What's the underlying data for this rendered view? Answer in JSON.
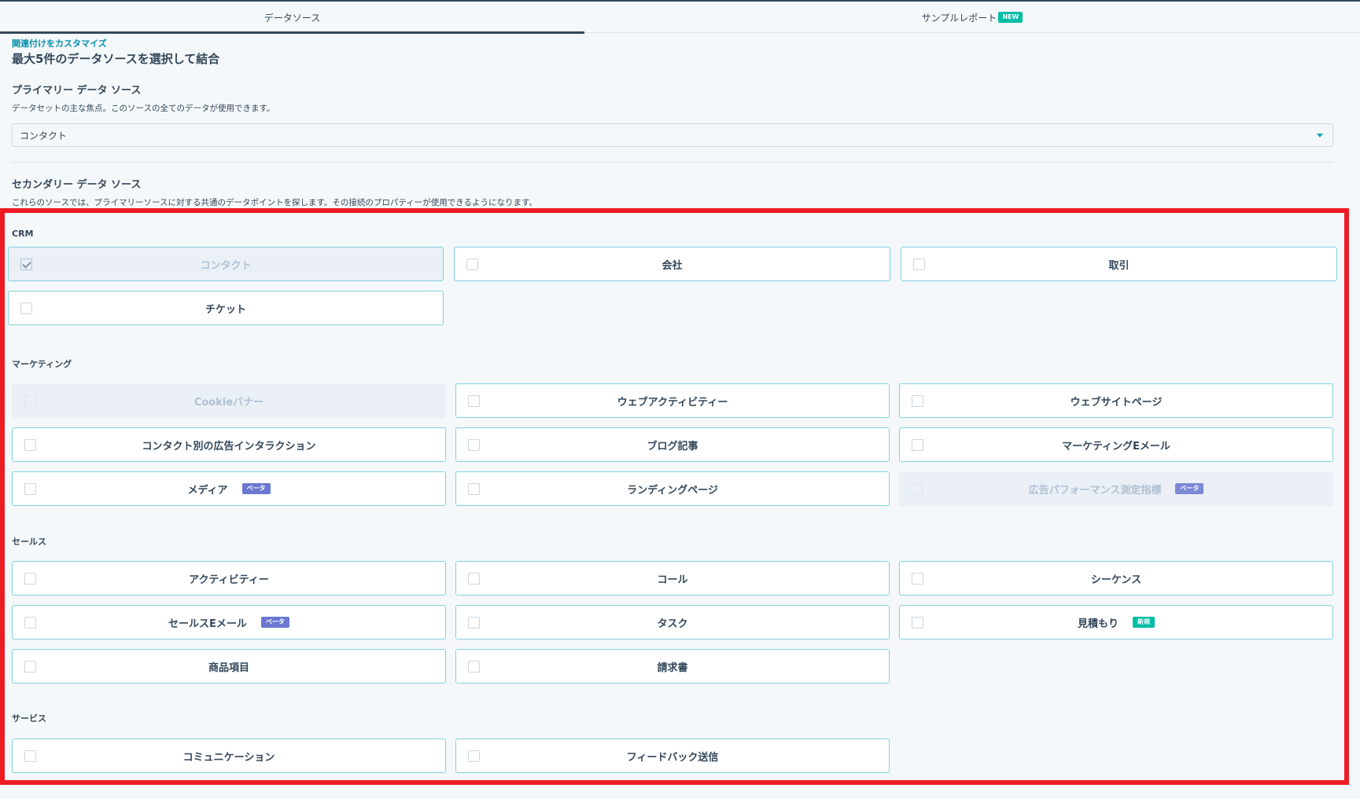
{
  "tabs": [
    {
      "label": "データソース",
      "active": true
    },
    {
      "label": "サンプルレポート",
      "badge": "NEW"
    }
  ],
  "header": {
    "customize_link": "関連付けをカスタマイズ",
    "title": "最大5件のデータソースを選択して結合"
  },
  "primary": {
    "label": "プライマリー データ ソース",
    "description": "データセットの主な焦点。このソースの全てのデータが使用できます。",
    "selected": "コンタクト"
  },
  "secondary": {
    "label": "セカンダリー データ ソース",
    "description": "これらのソースでは、プライマリーソースに対する共通のデータポイントを探します。その接続のプロパティーが使用できるようになります。"
  },
  "categories": {
    "crm": {
      "label": "CRM",
      "items": [
        {
          "label": "コンタクト",
          "state": "checked"
        },
        {
          "label": "会社"
        },
        {
          "label": "取引"
        },
        {
          "label": "チケット"
        }
      ]
    },
    "marketing": {
      "label": "マーケティング",
      "items": [
        {
          "label": "Cookieバナー",
          "state": "disabled"
        },
        {
          "label": "ウェブアクティビティー"
        },
        {
          "label": "ウェブサイトページ"
        },
        {
          "label": "コンタクト別の広告インタラクション"
        },
        {
          "label": "ブログ記事"
        },
        {
          "label": "マーケティングEメール"
        },
        {
          "label": "メディア",
          "badge": "ベータ"
        },
        {
          "label": "ランディングページ"
        },
        {
          "label": "広告パフォーマンス測定指標",
          "badge": "ベータ",
          "state": "disabled"
        }
      ]
    },
    "sales": {
      "label": "セールス",
      "items": [
        {
          "label": "アクティビティー"
        },
        {
          "label": "コール"
        },
        {
          "label": "シーケンス"
        },
        {
          "label": "セールスEメール",
          "badge": "ベータ"
        },
        {
          "label": "タスク"
        },
        {
          "label": "見積もり",
          "badge": "新規"
        },
        {
          "label": "商品項目"
        },
        {
          "label": "請求書"
        }
      ]
    },
    "service": {
      "label": "サービス",
      "items": [
        {
          "label": "コミュニケーション"
        },
        {
          "label": "フィードバック送信"
        }
      ]
    }
  },
  "colors": {
    "accent": "#00a4bd",
    "highlight_border": "#ed1c24",
    "beta_badge": "#6a78d1",
    "new_badge": "#00bda5"
  }
}
